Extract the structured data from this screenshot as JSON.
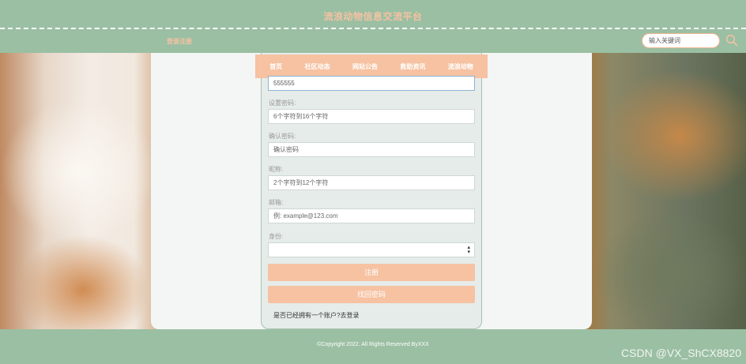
{
  "header": {
    "site_title": "流浪动物信息交流平台",
    "login_register": "登录注册",
    "search_placeholder": "输入关键词"
  },
  "nav": {
    "items": [
      "首页",
      "社区动态",
      "网站公告",
      "救助资讯",
      "流浪动物"
    ]
  },
  "form": {
    "username_value": "555555",
    "password_label": "设置密码:",
    "password_placeholder": "6个字符到16个字符",
    "confirm_label": "确认密码:",
    "confirm_placeholder": "确认密码",
    "nickname_label": "昵称:",
    "nickname_placeholder": "2个字符到12个字符",
    "email_label": "邮箱:",
    "email_placeholder": "例: example@123.com",
    "identity_label": "身份:",
    "identity_value": "",
    "register_button": "注册",
    "recover_button": "找回密码",
    "login_prompt": "是否已经拥有一个账户?去登录"
  },
  "footer": {
    "copyright": "©Copyright 2022. All Rights Reserved ByXXX",
    "watermark": "CSDN @VX_ShCX8820"
  },
  "colors": {
    "header_green": "#9bbfa3",
    "accent_peach": "#f6c2a2"
  }
}
